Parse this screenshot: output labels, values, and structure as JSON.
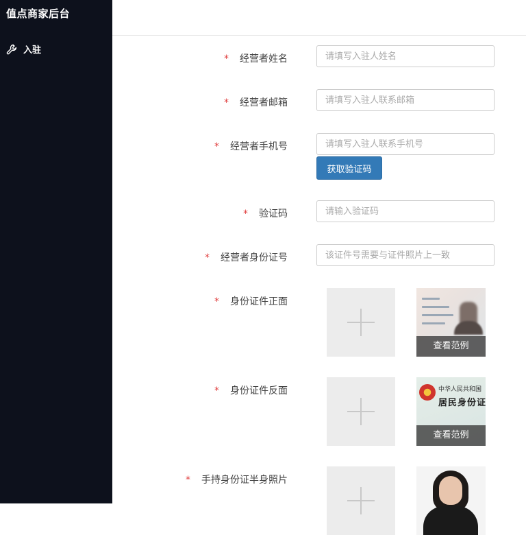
{
  "sidebar": {
    "brand": "值点商家后台",
    "nav": [
      {
        "label": "入驻",
        "icon": "wrench-icon"
      }
    ]
  },
  "form": {
    "name": {
      "label": "经营者姓名",
      "placeholder": "请填写入驻人姓名"
    },
    "email": {
      "label": "经营者邮箱",
      "placeholder": "请填写入驻人联系邮箱"
    },
    "phone": {
      "label": "经营者手机号",
      "placeholder": "请填写入驻人联系手机号"
    },
    "get_code_button": "获取验证码",
    "code": {
      "label": "验证码",
      "placeholder": "请输入验证码"
    },
    "id_number": {
      "label": "经营者身份证号",
      "placeholder": "该证件号需要与证件照片上一致"
    },
    "id_front": {
      "label": "身份证件正面",
      "sample_caption": "查看范例"
    },
    "id_back": {
      "label": "身份证件反面",
      "sample_caption": "查看范例",
      "sample_text_top": "中华人民共和国",
      "sample_text_main": "居民身份证"
    },
    "id_hold": {
      "label": "手持身份证半身照片"
    },
    "required_mark": "*"
  },
  "colors": {
    "sidebar_bg": "#0d111c",
    "primary_button": "#337ab7",
    "required": "#e03c3c"
  }
}
